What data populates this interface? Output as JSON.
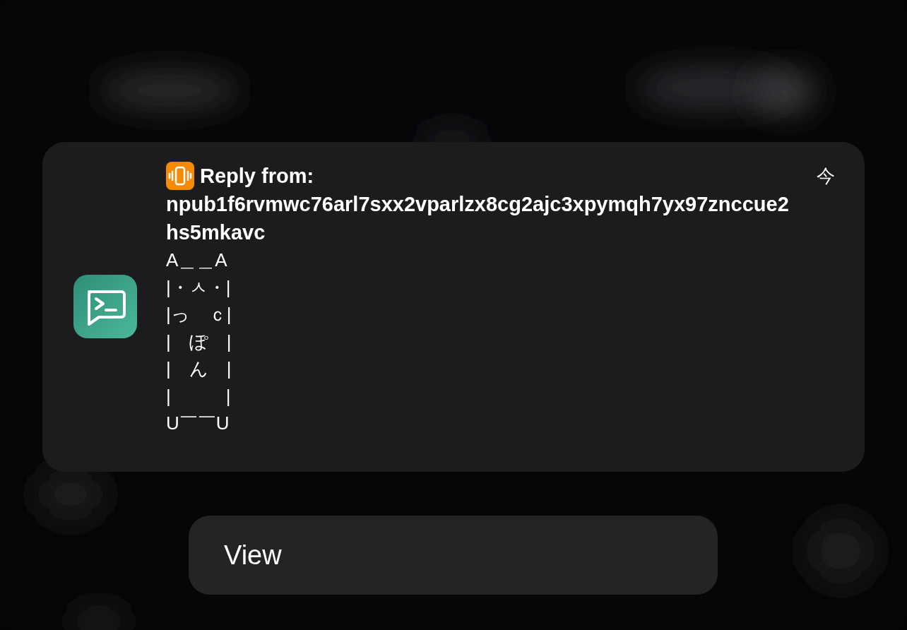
{
  "notification": {
    "title": "Reply from:",
    "sender": "npub1f6rvmwc76arl7sxx2vparlzx8cg2ajc3xpymqh7yx97znccue2hs5mkavc",
    "time": "今",
    "body_lines": [
      "A＿＿A",
      "|・ㅅ・|",
      "|っ　ｃ|",
      "|　ぽ　|",
      "|　ん　|",
      "|　　　|",
      "U￣￣U"
    ]
  },
  "actions": [
    {
      "label": "View"
    }
  ]
}
